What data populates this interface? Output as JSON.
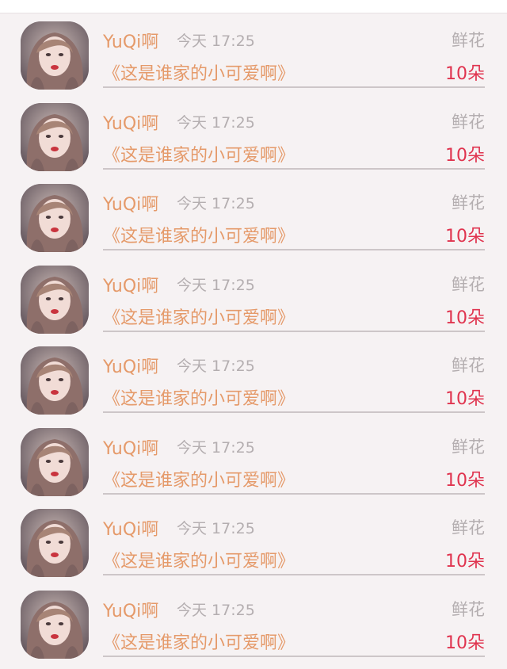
{
  "items": [
    {
      "name": "YuQi啊",
      "time": "今天 17:25",
      "gift": "鲜花",
      "title": "《这是谁家的小可爱啊》",
      "count": "10朵"
    },
    {
      "name": "YuQi啊",
      "time": "今天 17:25",
      "gift": "鲜花",
      "title": "《这是谁家的小可爱啊》",
      "count": "10朵"
    },
    {
      "name": "YuQi啊",
      "time": "今天 17:25",
      "gift": "鲜花",
      "title": "《这是谁家的小可爱啊》",
      "count": "10朵"
    },
    {
      "name": "YuQi啊",
      "time": "今天 17:25",
      "gift": "鲜花",
      "title": "《这是谁家的小可爱啊》",
      "count": "10朵"
    },
    {
      "name": "YuQi啊",
      "time": "今天 17:25",
      "gift": "鲜花",
      "title": "《这是谁家的小可爱啊》",
      "count": "10朵"
    },
    {
      "name": "YuQi啊",
      "time": "今天 17:25",
      "gift": "鲜花",
      "title": "《这是谁家的小可爱啊》",
      "count": "10朵"
    },
    {
      "name": "YuQi啊",
      "time": "今天 17:25",
      "gift": "鲜花",
      "title": "《这是谁家的小可爱啊》",
      "count": "10朵"
    },
    {
      "name": "YuQi啊",
      "time": "今天 17:25",
      "gift": "鲜花",
      "title": "《这是谁家的小可爱啊》",
      "count": "10朵"
    }
  ],
  "colors": {
    "accent_orange": "#e59a6a",
    "count_red": "#e0344f",
    "muted_text": "#b4aeb0",
    "background": "#f6f2f3"
  }
}
